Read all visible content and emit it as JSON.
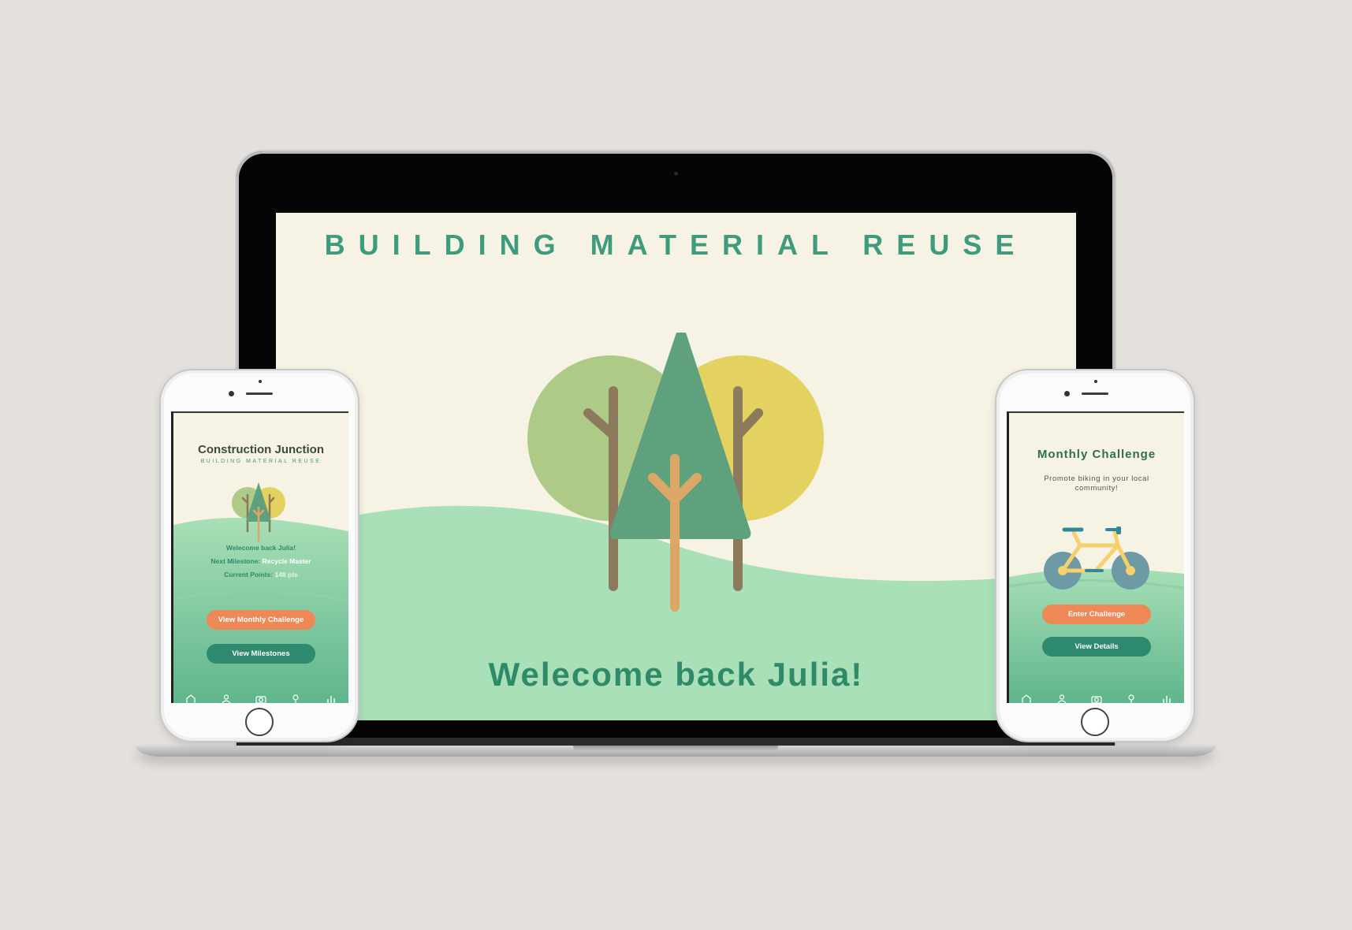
{
  "laptop": {
    "title": "BUILDING MATERIAL REUSE",
    "welcome": "Welecome back Julia!"
  },
  "phone_left": {
    "app_name": "Construction Junction",
    "subtitle": "BUILDING MATERIAL REUSE",
    "welcome": "Welecome back Julia!",
    "milestone_label": "Next Milestone:",
    "milestone_value": "Recycle Master",
    "points_label": "Current Points:",
    "points_value": "148 pts",
    "button_challenge": "View Monthly Challenge",
    "button_milestones": "View Milestones",
    "tabs": [
      "home-icon",
      "profile-icon",
      "camera-icon",
      "location-icon",
      "stats-icon"
    ]
  },
  "phone_right": {
    "title": "Monthly Challenge",
    "description": "Promote biking in your local community!",
    "button_enter": "Enter Challenge",
    "button_details": "View Details",
    "tabs": [
      "home-icon",
      "profile-icon",
      "camera-icon",
      "location-icon",
      "stats-icon"
    ]
  },
  "colors": {
    "background": "#e4e1dc",
    "screen_cream": "#f6f2e4",
    "green_title": "#3f9b7d",
    "hill_green": "#a9e0b8",
    "tree_green": "#5fa07d",
    "tree_light": "#adcb87",
    "tree_yellow": "#e3d25f",
    "orange_button": "#ee8957",
    "teal_button": "#2e8a6e"
  }
}
